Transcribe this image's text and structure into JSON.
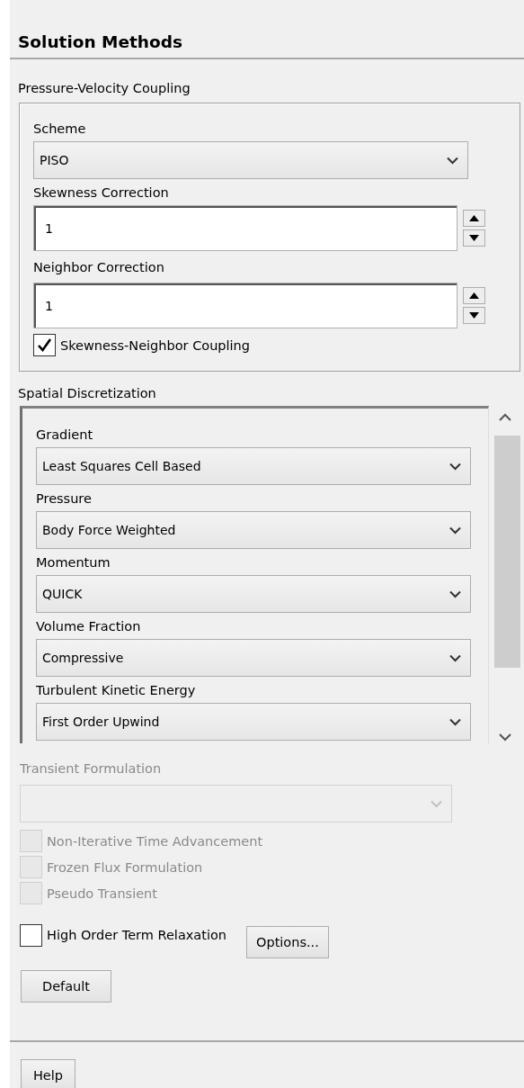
{
  "title": "Solution Methods",
  "pressure_velocity_coupling": {
    "label": "Pressure-Velocity Coupling",
    "fields": [
      {
        "kind": "dropdown",
        "label": "Scheme",
        "value": "PISO"
      },
      {
        "kind": "spinner",
        "label": "Skewness Correction",
        "value": "1"
      },
      {
        "kind": "spinner",
        "label": "Neighbor Correction",
        "value": "1"
      },
      {
        "kind": "checkbox",
        "label": "Skewness-Neighbor Coupling",
        "checked": true
      }
    ]
  },
  "spatial_discretization": {
    "label": "Spatial Discretization",
    "fields": [
      {
        "label": "Gradient",
        "value": "Least Squares Cell Based"
      },
      {
        "label": "Pressure",
        "value": "Body Force Weighted"
      },
      {
        "label": "Momentum",
        "value": "QUICK"
      },
      {
        "label": "Volume Fraction",
        "value": "Compressive"
      },
      {
        "label": "Turbulent Kinetic Energy",
        "value": "First Order Upwind"
      }
    ]
  },
  "transient_formulation": {
    "label": "Transient Formulation",
    "disabled": true
  },
  "options": [
    {
      "label": "Non-Iterative Time Advancement",
      "checked": false,
      "disabled": true
    },
    {
      "label": "Frozen Flux Formulation",
      "checked": false,
      "disabled": true
    },
    {
      "label": "Pseudo Transient",
      "checked": false,
      "disabled": true
    },
    {
      "label": "High Order Term Relaxation",
      "checked": false,
      "disabled": false
    }
  ],
  "options_button": "Options...",
  "default_button": "Default",
  "help_button": "Help"
}
